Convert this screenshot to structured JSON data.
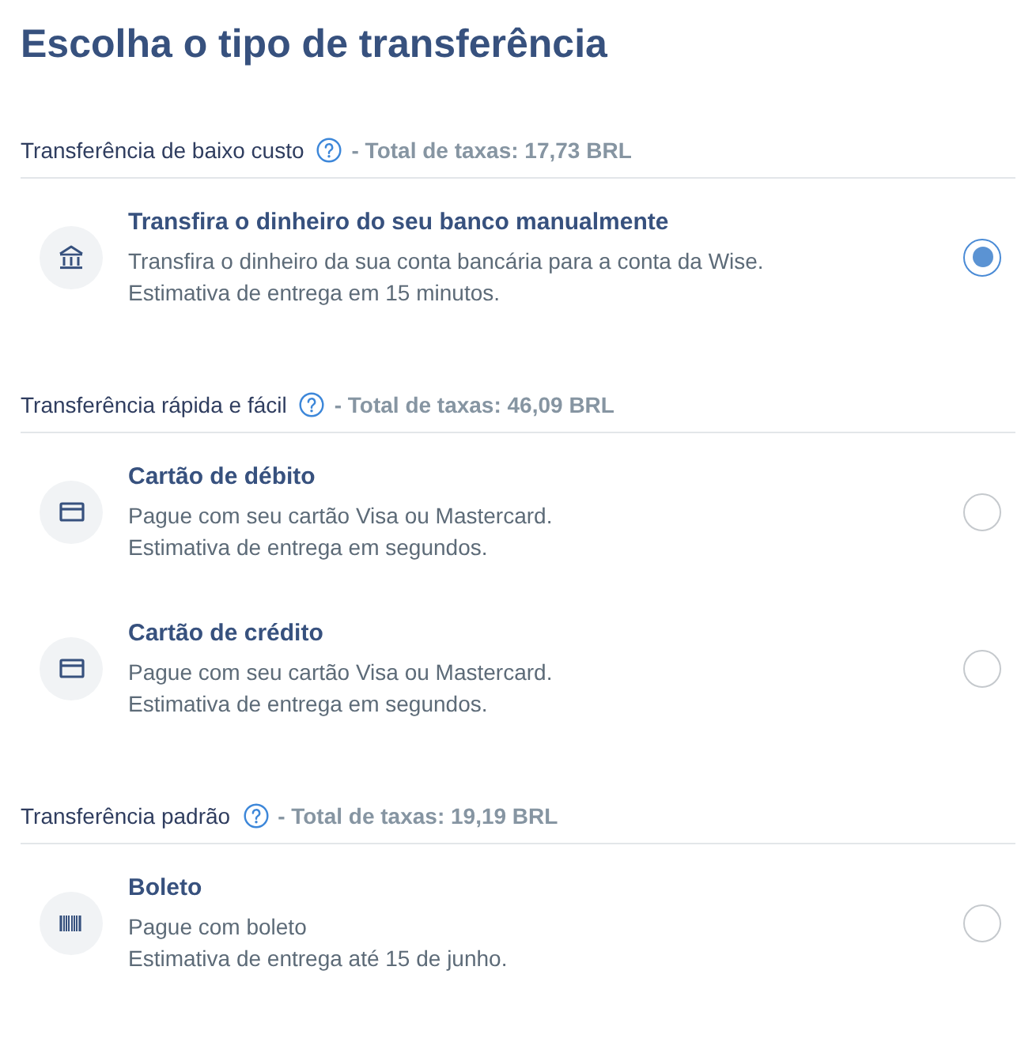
{
  "title": "Escolha o tipo de transferência",
  "sections": [
    {
      "label": "Transferência de baixo custo",
      "fee": "- Total de taxas: 17,73 BRL",
      "options": [
        {
          "kind": "bank",
          "title": "Transfira o dinheiro do seu banco manualmente",
          "description": [
            "Transfira o dinheiro da sua conta bancária para a conta da Wise.",
            "Estimativa de entrega em 15 minutos."
          ],
          "selected": true
        }
      ]
    },
    {
      "label": "Transferência rápida e fácil",
      "fee": "- Total de taxas: 46,09 BRL",
      "options": [
        {
          "kind": "card",
          "title": "Cartão de débito",
          "description": [
            "Pague com seu cartão Visa ou Mastercard.",
            "Estimativa de entrega em segundos."
          ],
          "selected": false
        },
        {
          "kind": "card",
          "title": "Cartão de crédito",
          "description": [
            "Pague com seu cartão Visa ou Mastercard.",
            "Estimativa de entrega em segundos."
          ],
          "selected": false
        }
      ]
    },
    {
      "label": "Transferência padrão",
      "fee": "- Total de taxas: 19,19 BRL",
      "options": [
        {
          "kind": "barcode",
          "title": "Boleto",
          "description": [
            "Pague com boleto",
            "Estimativa de entrega até 15 de junho."
          ],
          "selected": false
        }
      ]
    }
  ]
}
